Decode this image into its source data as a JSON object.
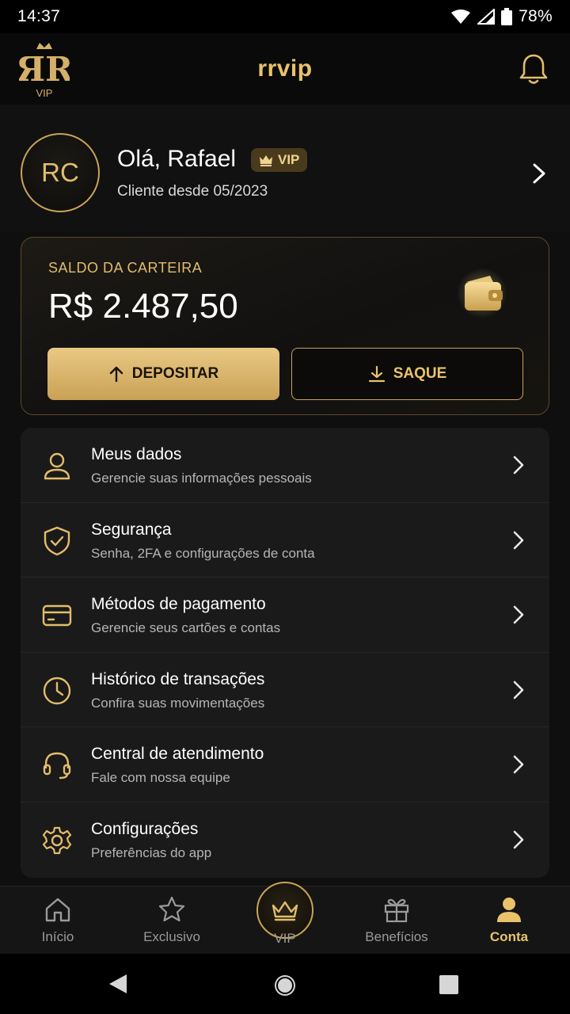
{
  "status_bar": {
    "time": "14:37",
    "battery": "78%"
  },
  "header": {
    "title": "rrvip",
    "logo_text": "VIP"
  },
  "profile": {
    "initials": "RC",
    "greeting": "Olá, Rafael",
    "badge": "VIP",
    "since": "Cliente desde 05/2023"
  },
  "wallet": {
    "label": "SALDO DA CARTEIRA",
    "amount": "R$ 2.487,50",
    "deposit_label": "DEPOSITAR",
    "withdraw_label": "SAQUE"
  },
  "menu": [
    {
      "title": "Meus dados",
      "subtitle": "Gerencie suas informações pessoais",
      "icon": "user-icon"
    },
    {
      "title": "Segurança",
      "subtitle": "Senha, 2FA e configurações de conta",
      "icon": "shield-icon"
    },
    {
      "title": "Métodos de pagamento",
      "subtitle": "Gerencie seus cartões e contas",
      "icon": "card-icon"
    },
    {
      "title": "Histórico de transações",
      "subtitle": "Confira suas movimentações",
      "icon": "clock-icon"
    },
    {
      "title": "Central de atendimento",
      "subtitle": "Fale com nossa equipe",
      "icon": "headset-icon"
    },
    {
      "title": "Configurações",
      "subtitle": "Preferências do app",
      "icon": "gear-icon"
    }
  ],
  "nav": {
    "home": "Início",
    "exclusive": "Exclusivo",
    "vip": "VIP",
    "benefits": "Benefícios",
    "account": "Conta"
  },
  "colors": {
    "gold": "#e9c36c",
    "gold_dark": "#c9a455",
    "background": "#0f0f0f",
    "card": "#1a1a1a"
  }
}
